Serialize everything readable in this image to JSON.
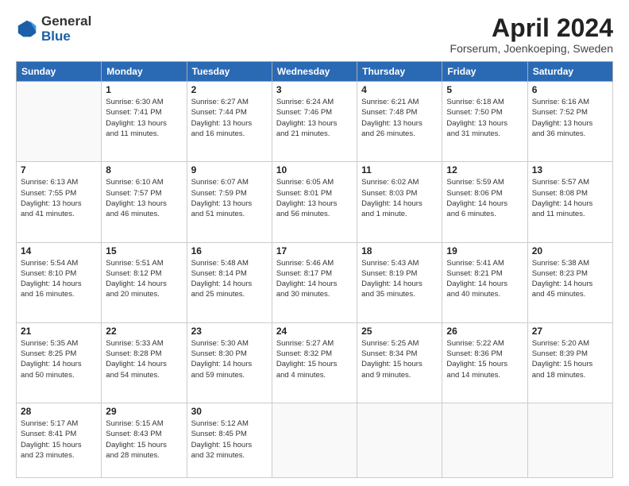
{
  "header": {
    "logo_general": "General",
    "logo_blue": "Blue",
    "month_title": "April 2024",
    "location": "Forserum, Joenkoeping, Sweden"
  },
  "days_of_week": [
    "Sunday",
    "Monday",
    "Tuesday",
    "Wednesday",
    "Thursday",
    "Friday",
    "Saturday"
  ],
  "weeks": [
    [
      {
        "day": "",
        "info": ""
      },
      {
        "day": "1",
        "info": "Sunrise: 6:30 AM\nSunset: 7:41 PM\nDaylight: 13 hours\nand 11 minutes."
      },
      {
        "day": "2",
        "info": "Sunrise: 6:27 AM\nSunset: 7:44 PM\nDaylight: 13 hours\nand 16 minutes."
      },
      {
        "day": "3",
        "info": "Sunrise: 6:24 AM\nSunset: 7:46 PM\nDaylight: 13 hours\nand 21 minutes."
      },
      {
        "day": "4",
        "info": "Sunrise: 6:21 AM\nSunset: 7:48 PM\nDaylight: 13 hours\nand 26 minutes."
      },
      {
        "day": "5",
        "info": "Sunrise: 6:18 AM\nSunset: 7:50 PM\nDaylight: 13 hours\nand 31 minutes."
      },
      {
        "day": "6",
        "info": "Sunrise: 6:16 AM\nSunset: 7:52 PM\nDaylight: 13 hours\nand 36 minutes."
      }
    ],
    [
      {
        "day": "7",
        "info": "Sunrise: 6:13 AM\nSunset: 7:55 PM\nDaylight: 13 hours\nand 41 minutes."
      },
      {
        "day": "8",
        "info": "Sunrise: 6:10 AM\nSunset: 7:57 PM\nDaylight: 13 hours\nand 46 minutes."
      },
      {
        "day": "9",
        "info": "Sunrise: 6:07 AM\nSunset: 7:59 PM\nDaylight: 13 hours\nand 51 minutes."
      },
      {
        "day": "10",
        "info": "Sunrise: 6:05 AM\nSunset: 8:01 PM\nDaylight: 13 hours\nand 56 minutes."
      },
      {
        "day": "11",
        "info": "Sunrise: 6:02 AM\nSunset: 8:03 PM\nDaylight: 14 hours\nand 1 minute."
      },
      {
        "day": "12",
        "info": "Sunrise: 5:59 AM\nSunset: 8:06 PM\nDaylight: 14 hours\nand 6 minutes."
      },
      {
        "day": "13",
        "info": "Sunrise: 5:57 AM\nSunset: 8:08 PM\nDaylight: 14 hours\nand 11 minutes."
      }
    ],
    [
      {
        "day": "14",
        "info": "Sunrise: 5:54 AM\nSunset: 8:10 PM\nDaylight: 14 hours\nand 16 minutes."
      },
      {
        "day": "15",
        "info": "Sunrise: 5:51 AM\nSunset: 8:12 PM\nDaylight: 14 hours\nand 20 minutes."
      },
      {
        "day": "16",
        "info": "Sunrise: 5:48 AM\nSunset: 8:14 PM\nDaylight: 14 hours\nand 25 minutes."
      },
      {
        "day": "17",
        "info": "Sunrise: 5:46 AM\nSunset: 8:17 PM\nDaylight: 14 hours\nand 30 minutes."
      },
      {
        "day": "18",
        "info": "Sunrise: 5:43 AM\nSunset: 8:19 PM\nDaylight: 14 hours\nand 35 minutes."
      },
      {
        "day": "19",
        "info": "Sunrise: 5:41 AM\nSunset: 8:21 PM\nDaylight: 14 hours\nand 40 minutes."
      },
      {
        "day": "20",
        "info": "Sunrise: 5:38 AM\nSunset: 8:23 PM\nDaylight: 14 hours\nand 45 minutes."
      }
    ],
    [
      {
        "day": "21",
        "info": "Sunrise: 5:35 AM\nSunset: 8:25 PM\nDaylight: 14 hours\nand 50 minutes."
      },
      {
        "day": "22",
        "info": "Sunrise: 5:33 AM\nSunset: 8:28 PM\nDaylight: 14 hours\nand 54 minutes."
      },
      {
        "day": "23",
        "info": "Sunrise: 5:30 AM\nSunset: 8:30 PM\nDaylight: 14 hours\nand 59 minutes."
      },
      {
        "day": "24",
        "info": "Sunrise: 5:27 AM\nSunset: 8:32 PM\nDaylight: 15 hours\nand 4 minutes."
      },
      {
        "day": "25",
        "info": "Sunrise: 5:25 AM\nSunset: 8:34 PM\nDaylight: 15 hours\nand 9 minutes."
      },
      {
        "day": "26",
        "info": "Sunrise: 5:22 AM\nSunset: 8:36 PM\nDaylight: 15 hours\nand 14 minutes."
      },
      {
        "day": "27",
        "info": "Sunrise: 5:20 AM\nSunset: 8:39 PM\nDaylight: 15 hours\nand 18 minutes."
      }
    ],
    [
      {
        "day": "28",
        "info": "Sunrise: 5:17 AM\nSunset: 8:41 PM\nDaylight: 15 hours\nand 23 minutes."
      },
      {
        "day": "29",
        "info": "Sunrise: 5:15 AM\nSunset: 8:43 PM\nDaylight: 15 hours\nand 28 minutes."
      },
      {
        "day": "30",
        "info": "Sunrise: 5:12 AM\nSunset: 8:45 PM\nDaylight: 15 hours\nand 32 minutes."
      },
      {
        "day": "",
        "info": ""
      },
      {
        "day": "",
        "info": ""
      },
      {
        "day": "",
        "info": ""
      },
      {
        "day": "",
        "info": ""
      }
    ]
  ]
}
